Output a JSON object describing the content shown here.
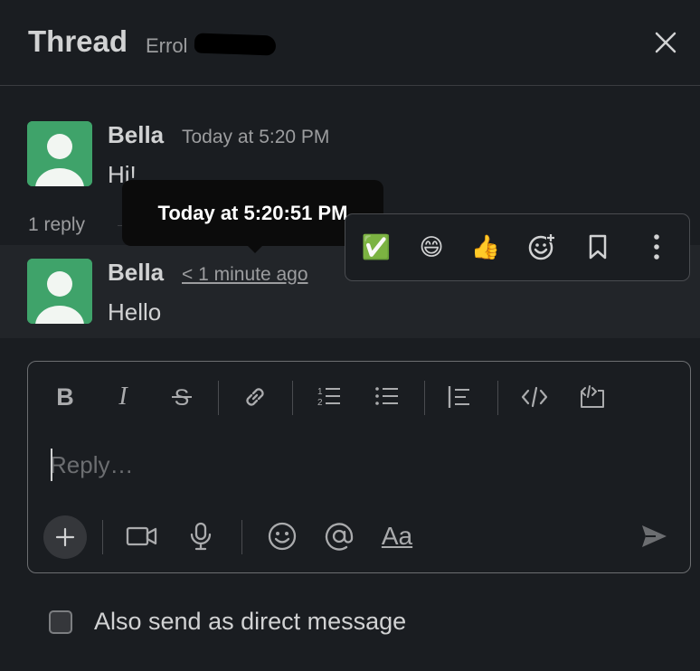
{
  "header": {
    "title": "Thread",
    "subtitle": "Errol",
    "close_icon": "close-icon"
  },
  "parent_message": {
    "author": "Bella",
    "time": "Today at 5:20 PM",
    "text": "Hi!",
    "avatar_color": "#3fa36a"
  },
  "reply_count": "1 reply",
  "reply_message": {
    "author": "Bella",
    "time": "< 1 minute ago",
    "text": "Hello",
    "avatar_color": "#3fa36a"
  },
  "tooltip": {
    "text": "Today at 5:20:51 PM"
  },
  "message_actions": [
    {
      "name": "check-mark-emoji",
      "glyph": "✅"
    },
    {
      "name": "grinning-emoji",
      "glyph": "😄"
    },
    {
      "name": "thumbs-up-emoji",
      "glyph": "👍"
    },
    {
      "name": "add-reaction-icon",
      "glyph": ""
    },
    {
      "name": "bookmark-icon",
      "glyph": ""
    },
    {
      "name": "more-actions-icon",
      "glyph": ""
    }
  ],
  "composer": {
    "placeholder": "Reply…",
    "toolbar": {
      "bold": "B",
      "italic": "I",
      "strike": "S",
      "ordered_list_1": "1",
      "ordered_list_2": "2"
    },
    "format_toggle": "Aa"
  },
  "also_send": {
    "label": "Also send as direct message",
    "checked": false
  },
  "colors": {
    "background": "#1a1d21",
    "hover_row": "#222529",
    "text": "#d1d2d3",
    "muted": "#9c9d9f",
    "tooltip_bg": "#0b0b0b"
  }
}
